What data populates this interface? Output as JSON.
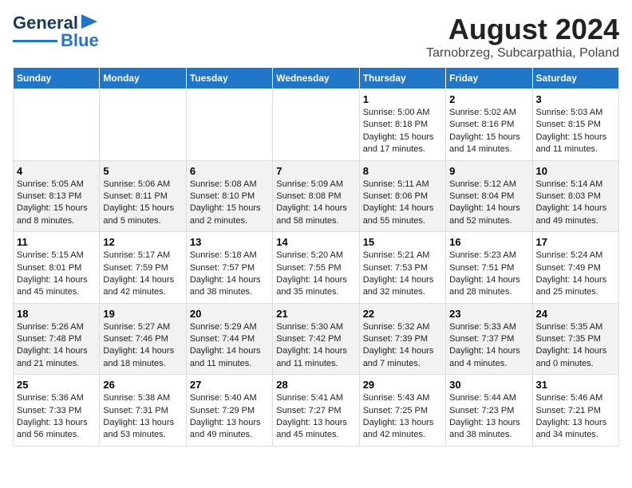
{
  "header": {
    "logo_line1": "General",
    "logo_line2": "Blue",
    "title": "August 2024",
    "subtitle": "Tarnobrzeg, Subcarpathia, Poland"
  },
  "days_of_week": [
    "Sunday",
    "Monday",
    "Tuesday",
    "Wednesday",
    "Thursday",
    "Friday",
    "Saturday"
  ],
  "weeks": [
    [
      {
        "day": "",
        "info": ""
      },
      {
        "day": "",
        "info": ""
      },
      {
        "day": "",
        "info": ""
      },
      {
        "day": "",
        "info": ""
      },
      {
        "day": "1",
        "info": "Sunrise: 5:00 AM\nSunset: 8:18 PM\nDaylight: 15 hours\nand 17 minutes."
      },
      {
        "day": "2",
        "info": "Sunrise: 5:02 AM\nSunset: 8:16 PM\nDaylight: 15 hours\nand 14 minutes."
      },
      {
        "day": "3",
        "info": "Sunrise: 5:03 AM\nSunset: 8:15 PM\nDaylight: 15 hours\nand 11 minutes."
      }
    ],
    [
      {
        "day": "4",
        "info": "Sunrise: 5:05 AM\nSunset: 8:13 PM\nDaylight: 15 hours\nand 8 minutes."
      },
      {
        "day": "5",
        "info": "Sunrise: 5:06 AM\nSunset: 8:11 PM\nDaylight: 15 hours\nand 5 minutes."
      },
      {
        "day": "6",
        "info": "Sunrise: 5:08 AM\nSunset: 8:10 PM\nDaylight: 15 hours\nand 2 minutes."
      },
      {
        "day": "7",
        "info": "Sunrise: 5:09 AM\nSunset: 8:08 PM\nDaylight: 14 hours\nand 58 minutes."
      },
      {
        "day": "8",
        "info": "Sunrise: 5:11 AM\nSunset: 8:06 PM\nDaylight: 14 hours\nand 55 minutes."
      },
      {
        "day": "9",
        "info": "Sunrise: 5:12 AM\nSunset: 8:04 PM\nDaylight: 14 hours\nand 52 minutes."
      },
      {
        "day": "10",
        "info": "Sunrise: 5:14 AM\nSunset: 8:03 PM\nDaylight: 14 hours\nand 49 minutes."
      }
    ],
    [
      {
        "day": "11",
        "info": "Sunrise: 5:15 AM\nSunset: 8:01 PM\nDaylight: 14 hours\nand 45 minutes."
      },
      {
        "day": "12",
        "info": "Sunrise: 5:17 AM\nSunset: 7:59 PM\nDaylight: 14 hours\nand 42 minutes."
      },
      {
        "day": "13",
        "info": "Sunrise: 5:18 AM\nSunset: 7:57 PM\nDaylight: 14 hours\nand 38 minutes."
      },
      {
        "day": "14",
        "info": "Sunrise: 5:20 AM\nSunset: 7:55 PM\nDaylight: 14 hours\nand 35 minutes."
      },
      {
        "day": "15",
        "info": "Sunrise: 5:21 AM\nSunset: 7:53 PM\nDaylight: 14 hours\nand 32 minutes."
      },
      {
        "day": "16",
        "info": "Sunrise: 5:23 AM\nSunset: 7:51 PM\nDaylight: 14 hours\nand 28 minutes."
      },
      {
        "day": "17",
        "info": "Sunrise: 5:24 AM\nSunset: 7:49 PM\nDaylight: 14 hours\nand 25 minutes."
      }
    ],
    [
      {
        "day": "18",
        "info": "Sunrise: 5:26 AM\nSunset: 7:48 PM\nDaylight: 14 hours\nand 21 minutes."
      },
      {
        "day": "19",
        "info": "Sunrise: 5:27 AM\nSunset: 7:46 PM\nDaylight: 14 hours\nand 18 minutes."
      },
      {
        "day": "20",
        "info": "Sunrise: 5:29 AM\nSunset: 7:44 PM\nDaylight: 14 hours\nand 11 minutes."
      },
      {
        "day": "21",
        "info": "Sunrise: 5:30 AM\nSunset: 7:42 PM\nDaylight: 14 hours\nand 11 minutes."
      },
      {
        "day": "22",
        "info": "Sunrise: 5:32 AM\nSunset: 7:39 PM\nDaylight: 14 hours\nand 7 minutes."
      },
      {
        "day": "23",
        "info": "Sunrise: 5:33 AM\nSunset: 7:37 PM\nDaylight: 14 hours\nand 4 minutes."
      },
      {
        "day": "24",
        "info": "Sunrise: 5:35 AM\nSunset: 7:35 PM\nDaylight: 14 hours\nand 0 minutes."
      }
    ],
    [
      {
        "day": "25",
        "info": "Sunrise: 5:36 AM\nSunset: 7:33 PM\nDaylight: 13 hours\nand 56 minutes."
      },
      {
        "day": "26",
        "info": "Sunrise: 5:38 AM\nSunset: 7:31 PM\nDaylight: 13 hours\nand 53 minutes."
      },
      {
        "day": "27",
        "info": "Sunrise: 5:40 AM\nSunset: 7:29 PM\nDaylight: 13 hours\nand 49 minutes."
      },
      {
        "day": "28",
        "info": "Sunrise: 5:41 AM\nSunset: 7:27 PM\nDaylight: 13 hours\nand 45 minutes."
      },
      {
        "day": "29",
        "info": "Sunrise: 5:43 AM\nSunset: 7:25 PM\nDaylight: 13 hours\nand 42 minutes."
      },
      {
        "day": "30",
        "info": "Sunrise: 5:44 AM\nSunset: 7:23 PM\nDaylight: 13 hours\nand 38 minutes."
      },
      {
        "day": "31",
        "info": "Sunrise: 5:46 AM\nSunset: 7:21 PM\nDaylight: 13 hours\nand 34 minutes."
      }
    ]
  ]
}
